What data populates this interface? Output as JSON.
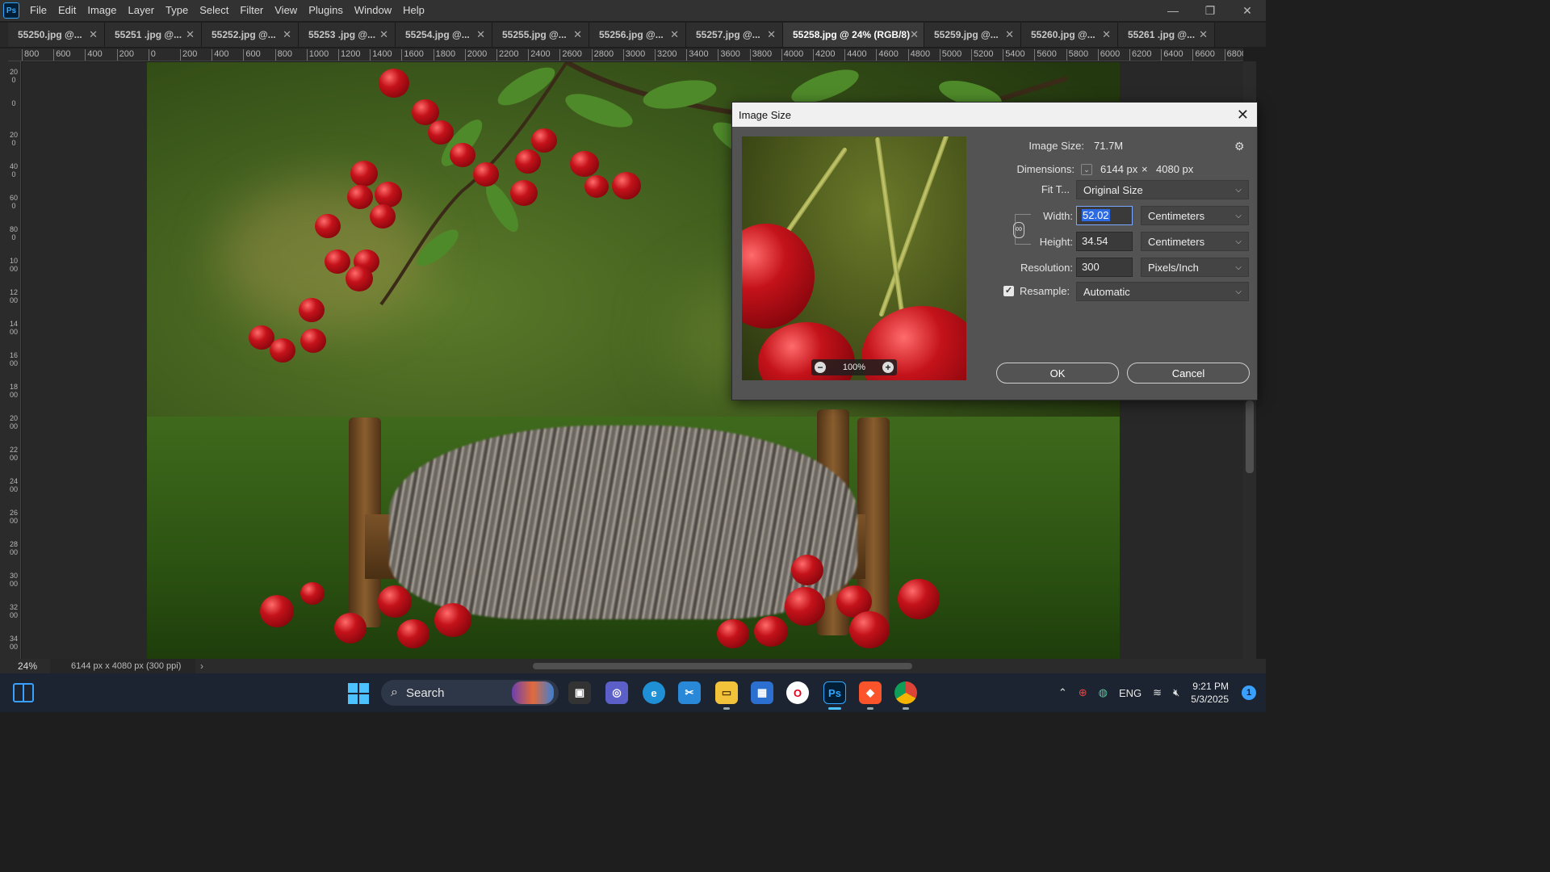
{
  "app": {
    "logo": "Ps"
  },
  "menu": [
    "File",
    "Edit",
    "Image",
    "Layer",
    "Type",
    "Select",
    "Filter",
    "View",
    "Plugins",
    "Window",
    "Help"
  ],
  "tabs": [
    {
      "label": "55250.jpg @...",
      "active": false
    },
    {
      "label": "55251 .jpg @...",
      "active": false
    },
    {
      "label": "55252.jpg @...",
      "active": false
    },
    {
      "label": "55253 .jpg @...",
      "active": false
    },
    {
      "label": "55254.jpg @...",
      "active": false
    },
    {
      "label": "55255.jpg @...",
      "active": false
    },
    {
      "label": "55256.jpg @...",
      "active": false
    },
    {
      "label": "55257.jpg @...",
      "active": false
    },
    {
      "label": "55258.jpg @ 24% (RGB/8)",
      "active": true
    },
    {
      "label": "55259.jpg @...",
      "active": false
    },
    {
      "label": "55260.jpg @...",
      "active": false
    },
    {
      "label": "55261 .jpg @...",
      "active": false
    }
  ],
  "ruler_top": [
    "800",
    "600",
    "400",
    "200",
    "0",
    "200",
    "400",
    "600",
    "800",
    "1000",
    "1200",
    "1400",
    "1600",
    "1800",
    "2000",
    "2200",
    "2400",
    "2600",
    "2800",
    "3000",
    "3200",
    "3400",
    "3600",
    "3800",
    "4000",
    "4200",
    "4400",
    "4600",
    "4800",
    "5000",
    "5200",
    "5400",
    "5600",
    "5800",
    "6000",
    "6200",
    "6400",
    "6600",
    "6800"
  ],
  "ruler_left": [
    "200",
    "0",
    "200",
    "400",
    "600",
    "800",
    "1000",
    "1200",
    "1400",
    "1600",
    "1800",
    "2000",
    "2200",
    "2400",
    "2600",
    "2800",
    "3000",
    "3200",
    "3400",
    "3600"
  ],
  "status": {
    "zoom": "24%",
    "doc_info": "6144 px x 4080 px (300 ppi)"
  },
  "dialog": {
    "title": "Image Size",
    "image_size_label": "Image Size:",
    "image_size_value": "71.7M",
    "dimensions_label": "Dimensions:",
    "dim_width": "6144 px",
    "dim_sep": "×",
    "dim_height": "4080 px",
    "fit_label": "Fit T...",
    "fit_value": "Original Size",
    "width_label": "Width:",
    "width_value": "52.02",
    "width_unit": "Centimeters",
    "height_label": "Height:",
    "height_value": "34.54",
    "height_unit": "Centimeters",
    "resolution_label": "Resolution:",
    "resolution_value": "300",
    "resolution_unit": "Pixels/Inch",
    "resample_label": "Resample:",
    "resample_checked": true,
    "resample_value": "Automatic",
    "preview_zoom": "100%",
    "ok_label": "OK",
    "cancel_label": "Cancel"
  },
  "taskbar": {
    "search_label": "Search",
    "language": "ENG",
    "time": "9:21 PM",
    "date": "5/3/2025",
    "notification_count": "1"
  }
}
